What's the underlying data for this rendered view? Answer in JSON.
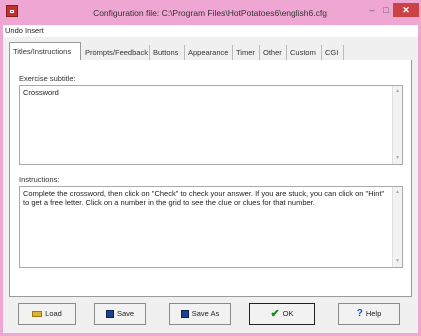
{
  "window": {
    "title": "Configuration file: C:\\Program Files\\HotPotatoes6\\english6.cfg",
    "controls": {
      "minimize": "–",
      "maximize": "□",
      "close": "✕"
    }
  },
  "menu": [
    "Undo",
    "Insert"
  ],
  "tabs": [
    {
      "label": "Titles/Instructions",
      "active": true
    },
    {
      "label": "Prompts/Feedback"
    },
    {
      "label": "Buttons"
    },
    {
      "label": "Appearance"
    },
    {
      "label": "Timer"
    },
    {
      "label": "Other"
    },
    {
      "label": "Custom"
    },
    {
      "label": "CGI"
    }
  ],
  "fields": {
    "subtitle_label": "Exercise subtitle:",
    "subtitle_value": "Crossword",
    "instructions_label": "Instructions:",
    "instructions_value": "Complete the crossword, then click on \"Check\" to check your answer. If you are stuck, you can click on \"Hint\" to get a free letter. Click on a number in the grid to see the clue or clues for that number."
  },
  "buttons": {
    "load": "Load",
    "save": "Save",
    "save_as": "Save As",
    "ok": "OK",
    "help": "Help"
  },
  "icons": {
    "scroll_up": "▲",
    "scroll_down": "▼",
    "ok": "✔",
    "help": "?"
  }
}
